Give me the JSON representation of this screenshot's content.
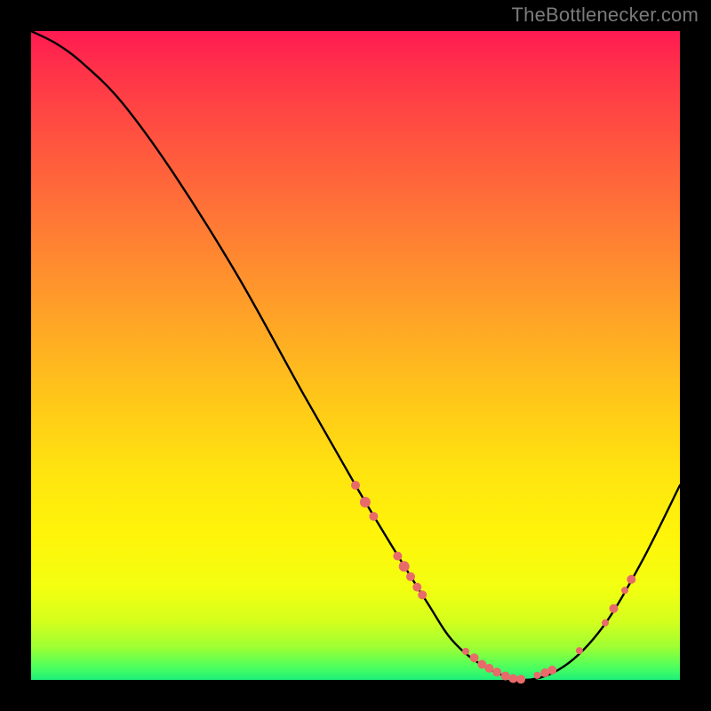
{
  "attribution": "TheBottlenecker.com",
  "chart_data": {
    "type": "line",
    "title": "",
    "xlabel": "",
    "ylabel": "",
    "xlim": [
      0,
      100
    ],
    "ylim": [
      0,
      100
    ],
    "series": [
      {
        "name": "bottleneck-curve",
        "x": [
          0,
          4,
          8,
          14,
          22,
          32,
          42,
          50,
          56,
          61,
          65,
          70,
          76,
          82,
          88,
          94,
          100
        ],
        "y": [
          100,
          98,
          95,
          89,
          78,
          62,
          44,
          30,
          20,
          12,
          6,
          2,
          0,
          2,
          8,
          18,
          30
        ]
      }
    ],
    "markers": {
      "name": "highlight-dots",
      "color": "#e86a6a",
      "points": [
        {
          "x": 50.0,
          "y": 30.0,
          "r": 5
        },
        {
          "x": 51.5,
          "y": 27.4,
          "r": 6
        },
        {
          "x": 52.8,
          "y": 25.2,
          "r": 5
        },
        {
          "x": 56.5,
          "y": 19.1,
          "r": 5
        },
        {
          "x": 57.5,
          "y": 17.5,
          "r": 6
        },
        {
          "x": 58.5,
          "y": 15.9,
          "r": 5
        },
        {
          "x": 59.5,
          "y": 14.3,
          "r": 5
        },
        {
          "x": 60.3,
          "y": 13.1,
          "r": 5
        },
        {
          "x": 67.0,
          "y": 4.4,
          "r": 4
        },
        {
          "x": 68.3,
          "y": 3.4,
          "r": 5
        },
        {
          "x": 69.5,
          "y": 2.4,
          "r": 5
        },
        {
          "x": 70.6,
          "y": 1.8,
          "r": 5
        },
        {
          "x": 71.8,
          "y": 1.2,
          "r": 5
        },
        {
          "x": 73.1,
          "y": 0.6,
          "r": 5
        },
        {
          "x": 74.3,
          "y": 0.2,
          "r": 5
        },
        {
          "x": 75.5,
          "y": 0.1,
          "r": 5
        },
        {
          "x": 78.0,
          "y": 0.7,
          "r": 4
        },
        {
          "x": 79.2,
          "y": 1.1,
          "r": 5
        },
        {
          "x": 80.3,
          "y": 1.5,
          "r": 5
        },
        {
          "x": 84.5,
          "y": 4.5,
          "r": 4
        },
        {
          "x": 88.5,
          "y": 8.8,
          "r": 4
        },
        {
          "x": 89.8,
          "y": 11.0,
          "r": 5
        },
        {
          "x": 91.5,
          "y": 13.8,
          "r": 4
        },
        {
          "x": 92.5,
          "y": 15.5,
          "r": 5
        }
      ]
    }
  }
}
